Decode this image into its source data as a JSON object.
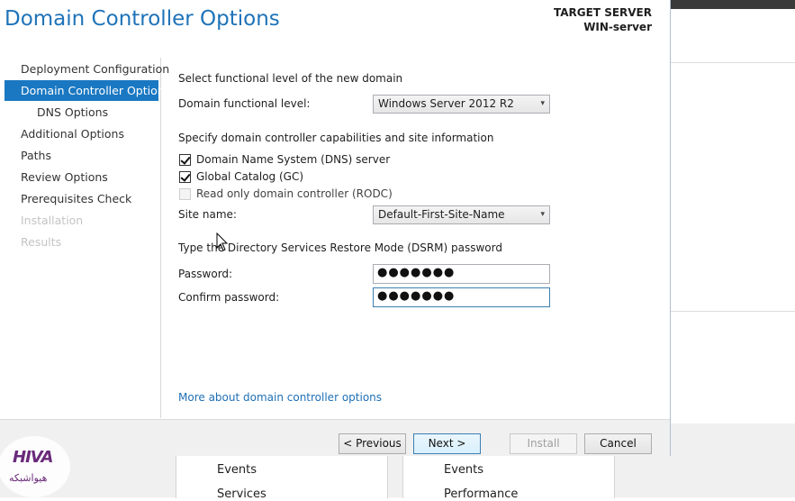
{
  "background": {
    "tiles": [
      {
        "line1": "Events",
        "line2": "Services"
      },
      {
        "line1": "Events",
        "line2": "Performance"
      }
    ]
  },
  "wizard": {
    "title": "Domain Controller Options",
    "target_label": "TARGET SERVER",
    "target_name": "WIN-server",
    "nav": [
      {
        "label": "Deployment Configuration",
        "state": "normal"
      },
      {
        "label": "Domain Controller Options",
        "state": "active"
      },
      {
        "label": "DNS Options",
        "state": "sub"
      },
      {
        "label": "Additional Options",
        "state": "normal"
      },
      {
        "label": "Paths",
        "state": "normal"
      },
      {
        "label": "Review Options",
        "state": "normal"
      },
      {
        "label": "Prerequisites Check",
        "state": "normal"
      },
      {
        "label": "Installation",
        "state": "disabled"
      },
      {
        "label": "Results",
        "state": "disabled"
      }
    ],
    "functional_heading": "Select functional level of the new domain",
    "domain_level_label": "Domain functional level:",
    "domain_level_value": "Windows Server 2012 R2",
    "capabilities_heading": "Specify domain controller capabilities and site information",
    "checkboxes": [
      {
        "label": "Domain Name System (DNS) server",
        "checked": true,
        "enabled": true
      },
      {
        "label": "Global Catalog (GC)",
        "checked": true,
        "enabled": true
      },
      {
        "label": "Read only domain controller (RODC)",
        "checked": false,
        "enabled": false
      }
    ],
    "site_label": "Site name:",
    "site_value": "Default-First-Site-Name",
    "dsrm_heading": "Type the Directory Services Restore Mode (DSRM) password",
    "password_label": "Password:",
    "password_value": "●●●●●●●",
    "confirm_label": "Confirm password:",
    "confirm_value": "●●●●●●●",
    "more_link": "More about domain controller options",
    "buttons": {
      "previous": "< Previous",
      "next": "Next >",
      "install": "Install",
      "cancel": "Cancel"
    }
  },
  "watermark": {
    "mark": "HIVA",
    "text": "هیواشبکه"
  }
}
